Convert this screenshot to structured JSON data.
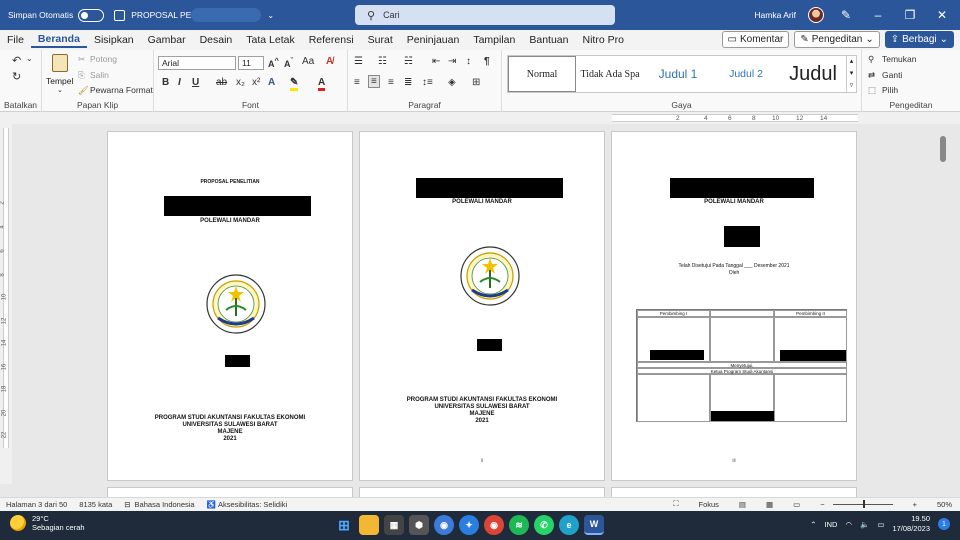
{
  "titlebar": {
    "autosave_label": "Simpan Otomatis",
    "doc_title": "PROPOSAL PE",
    "search_placeholder": "Cari",
    "user_name": "Hamka Arif"
  },
  "menu": {
    "items": [
      "File",
      "Beranda",
      "Sisipkan",
      "Gambar",
      "Desain",
      "Tata Letak",
      "Referensi",
      "Surat",
      "Peninjauan",
      "Tampilan",
      "Bantuan",
      "Nitro Pro"
    ],
    "active": "Beranda",
    "comment_label": "Komentar",
    "editing_label": "Pengeditan",
    "share_label": "Berbagi"
  },
  "ribbon": {
    "groups": {
      "undo": "Batalkan",
      "clipboard": "Papan Klip",
      "font": "Font",
      "paragraph": "Paragraf",
      "styles": "Gaya",
      "editing": "Pengeditan"
    },
    "clipboard": {
      "paste": "Tempel",
      "cut": "Potong",
      "copy": "Salin",
      "format_painter": "Pewarna Format"
    },
    "font_name": "Arial",
    "font_size": "11",
    "styles": [
      "Normal",
      "Tidak Ada Spa",
      "Judul 1",
      "Judul 2",
      "Judul"
    ],
    "editing": {
      "find": "Temukan",
      "replace": "Ganti",
      "select": "Pilih"
    }
  },
  "ruler": {
    "ticks": [
      "2",
      "4",
      "6",
      "8",
      "10",
      "12",
      "14"
    ]
  },
  "vruler": {
    "ticks": [
      "2",
      "4",
      "6",
      "8",
      "10",
      "12",
      "14",
      "16",
      "18",
      "20",
      "22"
    ]
  },
  "pages": {
    "p1": {
      "heading": "PROPOSAL PENELITIAN",
      "region": "POLEWALI MANDAR",
      "footer1": "PROGRAM STUDI AKUNTANSI FAKULTAS EKONOMI",
      "footer2": "UNIVERSITAS SULAWESI BARAT",
      "footer3": "MAJENE",
      "footer4": "2021"
    },
    "p2": {
      "region": "POLEWALI MANDAR",
      "footer1": "PROGRAM STUDI AKUNTANSI FAKULTAS EKONOMI",
      "footer2": "UNIVERSITAS SULAWESI BARAT",
      "footer3": "MAJENE",
      "footer4": "2021",
      "page_number": "ii"
    },
    "p3": {
      "region": "POLEWALI MANDAR",
      "approval_date": "Telah Disetujui Pada Tanggal ___ Desember 2021",
      "by": "Oleh",
      "advisor1": "Pembimbing I",
      "advisor2": "Pembimbing II",
      "agreed": "Menyetujui,",
      "head": "Ketua Program Studi Akuntansi",
      "page_number": "iii"
    }
  },
  "status": {
    "page": "Halaman 3 dari 50",
    "words": "8135 kata",
    "language": "Bahasa Indonesia",
    "accessibility": "Aksesibilitas: Selidiki",
    "focus": "Fokus",
    "zoom": "50%",
    "zoom_level": 0.5
  },
  "taskbar": {
    "temp": "29°C",
    "weather": "Sebagian cerah",
    "lang": "IND",
    "time": "19.50",
    "date": "17/08/2023",
    "notifications": "1"
  },
  "colors": {
    "word_blue": "#2b579a",
    "taskbar": "#1f2a3a"
  }
}
